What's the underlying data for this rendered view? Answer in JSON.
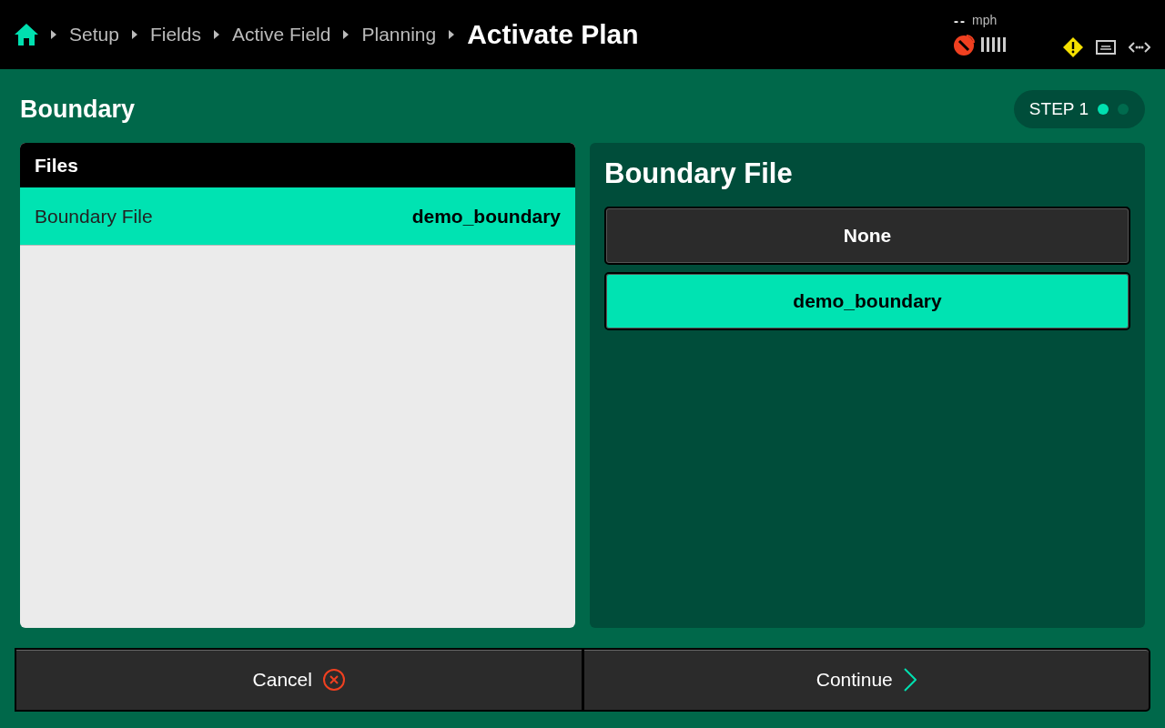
{
  "breadcrumbs": [
    {
      "label": "Setup"
    },
    {
      "label": "Fields"
    },
    {
      "label": "Active Field"
    },
    {
      "label": "Planning"
    }
  ],
  "page_title": "Activate Plan",
  "status": {
    "speed": "--",
    "unit": "mph"
  },
  "section_title": "Boundary",
  "step": {
    "label": "STEP 1",
    "dots": [
      {
        "selected": true
      },
      {
        "selected": false
      }
    ]
  },
  "files_panel": {
    "title": "Files",
    "rows": [
      {
        "label": "Boundary File",
        "value": "demo_boundary",
        "selected": true
      }
    ]
  },
  "detail_panel": {
    "title": "Boundary File",
    "options": [
      {
        "label": "None",
        "selected": false
      },
      {
        "label": "demo_boundary",
        "selected": true
      }
    ]
  },
  "footer": {
    "cancel": "Cancel",
    "continue": "Continue"
  }
}
